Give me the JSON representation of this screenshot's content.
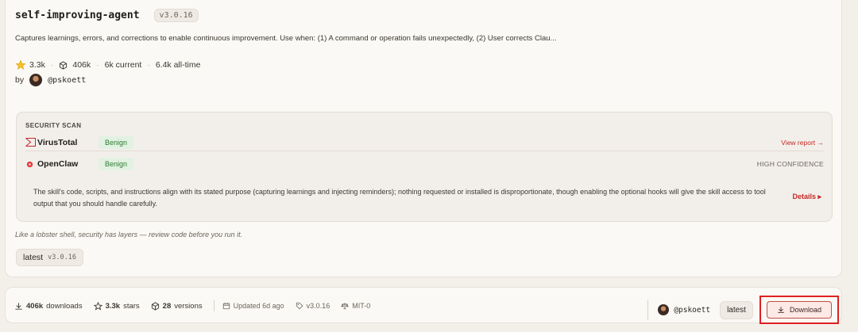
{
  "skill": {
    "name": "self-improving-agent",
    "version_badge": "v3.0.16",
    "description": "Captures learnings, errors, and corrections to enable continuous improvement. Use when: (1) A command or operation fails unexpectedly, (2) User corrects Clau...",
    "stats": {
      "stars": "3.3k",
      "downloads": "406k",
      "current": "6k current",
      "all_time": "6.4k all-time"
    },
    "by_label": "by",
    "author": "@pskoett"
  },
  "security_scan": {
    "heading": "SECURITY SCAN",
    "virustotal": {
      "name": "VirusTotal",
      "status": "Benign",
      "link": "View report →"
    },
    "openclaw": {
      "name": "OpenClaw",
      "status": "Benign",
      "confidence": "HIGH CONFIDENCE"
    },
    "explanation": "The skill's code, scripts, and instructions align with its stated purpose (capturing learnings and injecting reminders); nothing requested or installed is disproportionate, though enabling the optional hooks will give the skill access to tool output that you should handle carefully.",
    "details_label": "Details ▸"
  },
  "tagline": "Like a lobster shell, security has layers — review code before you run it.",
  "tag_chip": {
    "label": "latest",
    "version": "v3.0.16"
  },
  "footer": {
    "downloads_value": "406k",
    "downloads_label": "downloads",
    "stars_value": "3.3k",
    "stars_label": "stars",
    "versions_value": "28",
    "versions_label": "versions",
    "updated": "Updated 6d ago",
    "version": "v3.0.16",
    "license": "MIT-0",
    "author": "@pskoett",
    "latest_label": "latest",
    "download_label": "Download"
  },
  "colors": {
    "accent_red": "#c62828",
    "benign_green": "#2e7d32",
    "highlight_box": "#e02020"
  }
}
